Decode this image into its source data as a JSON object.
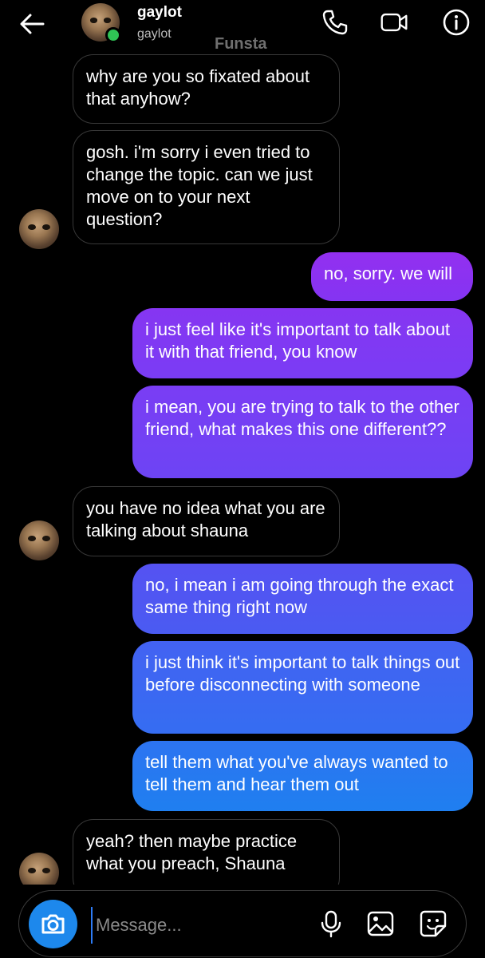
{
  "header": {
    "name": "gaylot",
    "username": "gaylot",
    "folder": "Funsta",
    "icons": [
      "back-arrow-icon",
      "phone-icon",
      "video-camera-icon",
      "info-icon"
    ]
  },
  "messages": [
    {
      "from": "them",
      "text": "why are you so fixated about that anyhow?"
    },
    {
      "from": "them",
      "text": "gosh. i'm sorry i even tried to change the topic. can we just move on to your next question?"
    },
    {
      "from": "me",
      "text": "no, sorry. we will"
    },
    {
      "from": "me",
      "text": "i just feel like it's important to talk about it with that friend, you know"
    },
    {
      "from": "me",
      "text": "i mean, you are trying to talk to the other friend, what makes this one different??"
    },
    {
      "from": "them",
      "text": "you have no idea what you are talking about shauna"
    },
    {
      "from": "me",
      "text": "no, i mean i am going through the exact same thing right now"
    },
    {
      "from": "me",
      "text": "i just think it's important to talk things out before disconnecting with someone"
    },
    {
      "from": "me",
      "text": "tell them what you've always wanted to tell them and hear them out"
    },
    {
      "from": "them",
      "text": "yeah? then maybe practice what you preach, Shauna"
    }
  ],
  "composer": {
    "placeholder": "Message...",
    "icons": [
      "camera-icon",
      "microphone-icon",
      "gallery-icon",
      "sticker-icon"
    ]
  },
  "colors": {
    "background": "#000000",
    "incoming_border": "#383838",
    "outgoing_gradient_top": "#8a2ef0",
    "outgoing_gradient_bottom": "#1f7bf0",
    "online": "#2fc255",
    "camera_button": "#1d88ec"
  }
}
